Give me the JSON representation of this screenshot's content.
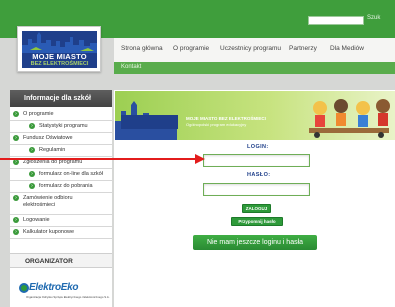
{
  "search": {
    "placeholder": "",
    "button_label": "Szuk"
  },
  "logo": {
    "title": "MOJE MIASTO",
    "subtitle": "BEZ ELEKTROŚMIECI"
  },
  "nav": {
    "items": [
      "Strona główna",
      "O programie",
      "Uczestnicy programu",
      "Partnerzy",
      "Dla Mediów"
    ]
  },
  "subnav": {
    "item": "Kontakt"
  },
  "sidebar": {
    "header": "Informacje dla szkół",
    "items": [
      {
        "label": "O programie",
        "indent": false
      },
      {
        "label": "Statystyki programu",
        "indent": true
      },
      {
        "label": "Fundusz Oświatowe",
        "indent": false
      },
      {
        "label": "Regulamin",
        "indent": true
      },
      {
        "label": "Zgłoszenia do programu",
        "indent": false
      },
      {
        "label": "formularz on-line dla szkół",
        "indent": true
      },
      {
        "label": "formularz do pobrania",
        "indent": true
      },
      {
        "label": "Zamówienie odbioru elektrośmieci",
        "indent": false
      },
      {
        "label": "Logowanie",
        "indent": false
      },
      {
        "label": "Kalkulator kuponowe",
        "indent": false
      }
    ],
    "organizer_header": "ORGANIZATOR",
    "organizer_logo": "ElektroEko",
    "organizer_tag": "Organizacja Odzysku Sprzętu Elektrycznego i Elektronicznego S.A."
  },
  "banner": {
    "title": "MOJE MIASTO BEZ ELEKTROŚMIECI",
    "subtitle": "Ogólnopolski program edukacyjny"
  },
  "form": {
    "login_label": "LOGIN:",
    "password_label": "HASŁO:",
    "login_value": "",
    "password_value": "",
    "login_button": "ZALOGUJ",
    "remind_button": "Przypomnij hasło",
    "no_account_button": "Nie mam jeszcze loginu i hasła"
  },
  "colors": {
    "brand_green": "#3f9e3c",
    "logo_blue": "#1f3f8a",
    "arrow_red": "#e31c1c"
  }
}
